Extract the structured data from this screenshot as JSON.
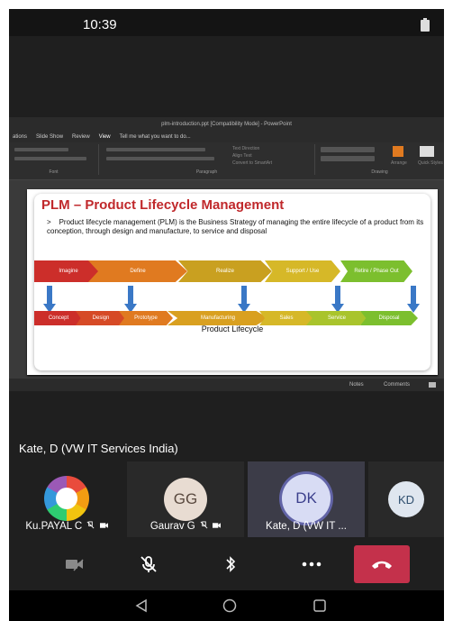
{
  "status_bar": {
    "time": "10:39",
    "icons": [
      "battery-icon"
    ]
  },
  "powerpoint": {
    "window_title": "plm-introduction.ppt [Compatibility Mode] - PowerPoint",
    "tabs": [
      "ations",
      "Slide Show",
      "Review",
      "View",
      "Tell me what you want to do..."
    ],
    "ribbon": {
      "font_label": "Font",
      "paragraph_label": "Paragraph",
      "drawing_label": "Drawing",
      "text_direction": "Text Direction",
      "align_text": "Align Text",
      "convert_smartart": "Convert to SmartArt",
      "arrange": "Arrange",
      "quick_styles": "Quick Styles"
    },
    "slide": {
      "title": "PLM – Product Lifecycle Management",
      "bullet_marker": ">",
      "body": "Product lifecycle management (PLM) is the Business Strategy of managing the entire lifecycle of a product from its conception, through design and manufacture, to service and disposal",
      "phases": [
        "Imagine",
        "Define",
        "Realize",
        "Support / Use",
        "Retire / Phase Out"
      ],
      "phase_colors": [
        "#cc2e2a",
        "#e07a20",
        "#c9a020",
        "#d6b828",
        "#7cbf2e"
      ],
      "stages": [
        "Concept",
        "Design",
        "Prototype",
        "Manufacturing",
        "Sales",
        "Service",
        "Disposal"
      ],
      "stage_colors": [
        "#cc2e2a",
        "#d64a26",
        "#e07a20",
        "#d9a020",
        "#d6b828",
        "#a9c42c",
        "#7cbf2e"
      ],
      "caption": "Product Lifecycle"
    },
    "status": {
      "notes": "Notes",
      "comments": "Comments"
    }
  },
  "meeting": {
    "active_speaker": "Kate, D (VW IT Services India)",
    "participants": [
      {
        "name": "Ku.PAYAL C",
        "initials": ""
      },
      {
        "name": "Gaurav G",
        "initials": "GG"
      },
      {
        "name": "Kate, D (VW IT ...",
        "initials": "DK"
      },
      {
        "name": "",
        "initials": "KD"
      }
    ],
    "controls": [
      "video-off-icon",
      "mic-off-icon",
      "bluetooth-icon",
      "more-icon",
      "hangup-icon"
    ],
    "hangup_color": "#c4314b"
  },
  "nav": [
    "back-icon",
    "home-icon",
    "recents-icon"
  ]
}
